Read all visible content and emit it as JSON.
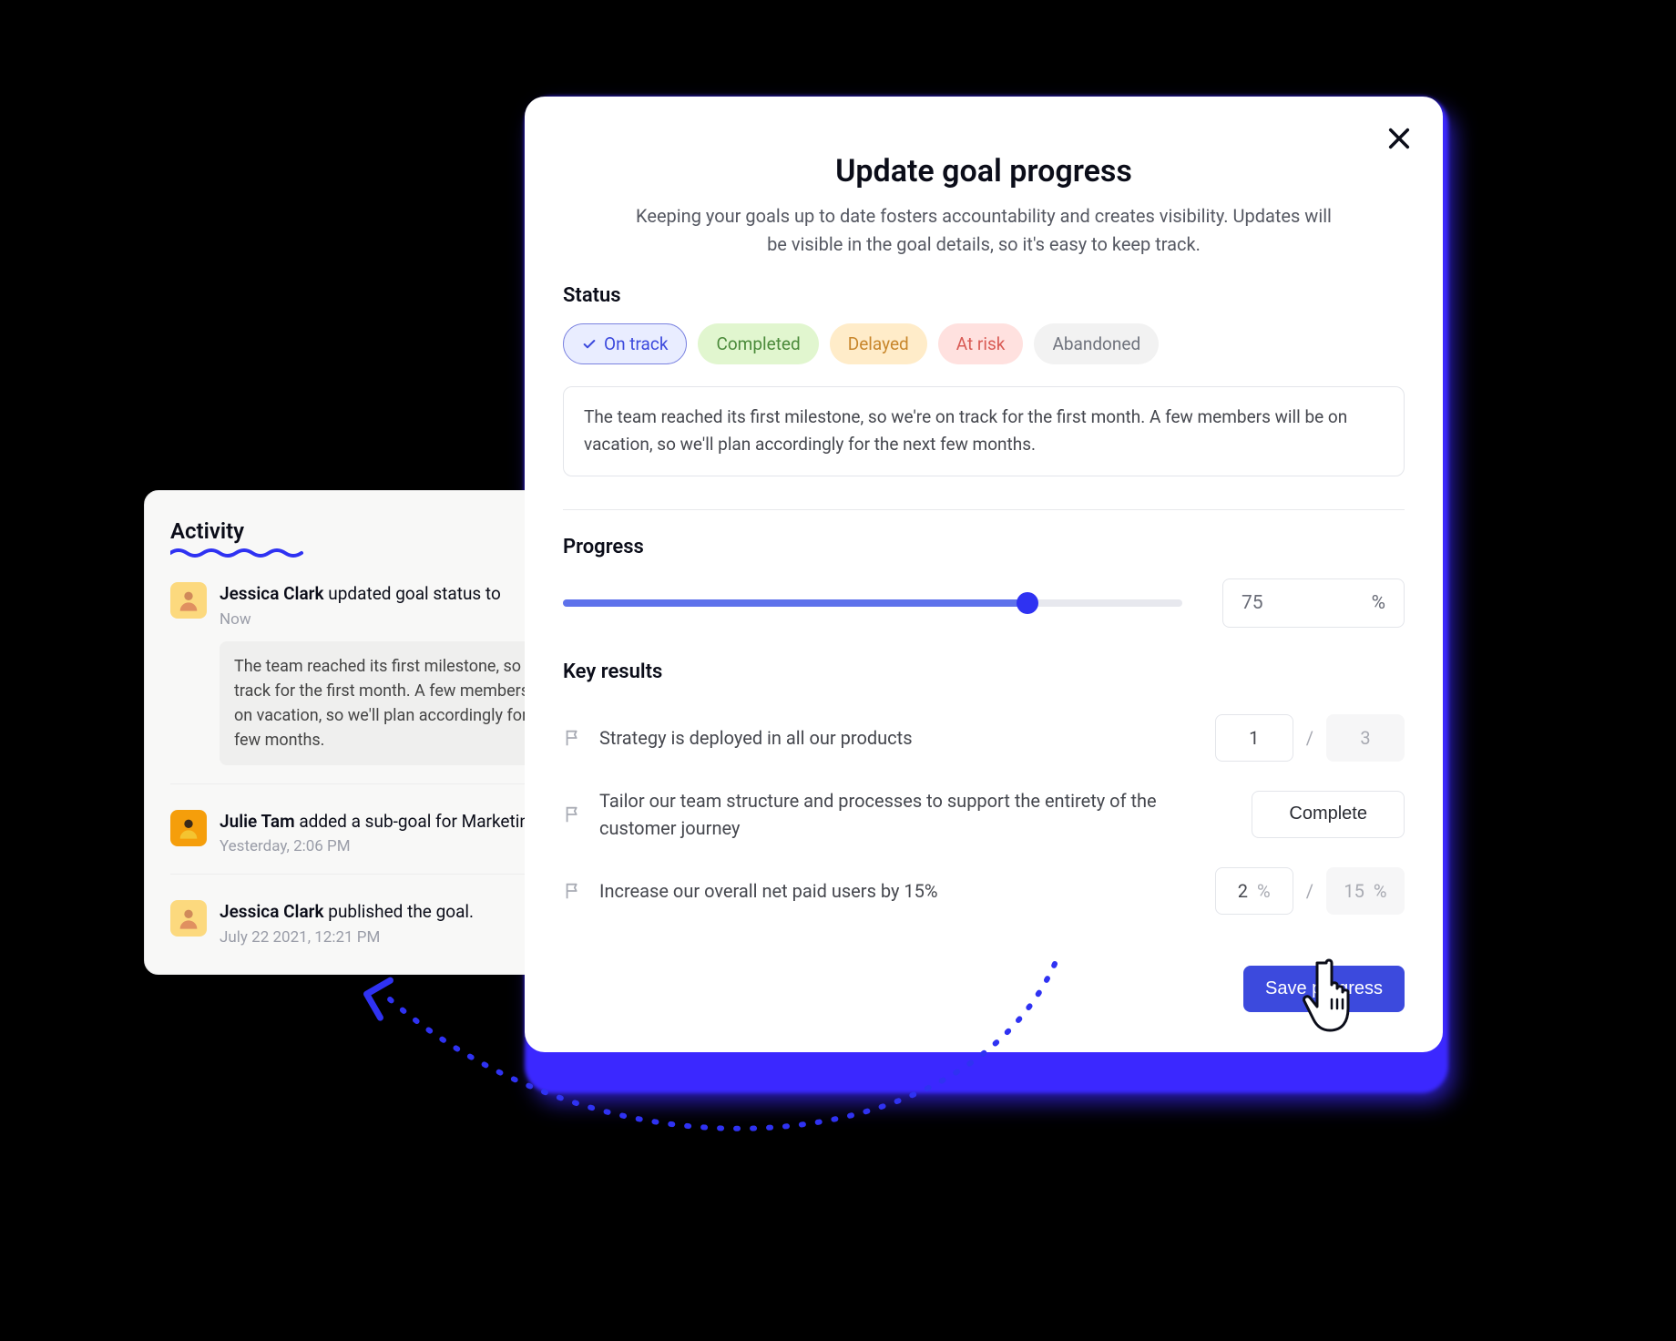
{
  "activity": {
    "title": "Activity",
    "items": [
      {
        "user": "Jessica Clark",
        "action": "updated goal status to",
        "time": "Now",
        "note": "The team reached its first milestone, so we're on track for the first month. A few members will be on vacation, so we'll plan accordingly for the next few months."
      },
      {
        "user": "Julie Tam",
        "action": "added a sub-goal for Marketing.",
        "time": "Yesterday, 2:06 PM"
      },
      {
        "user": "Jessica Clark",
        "action": "published the goal.",
        "time": "July 22 2021, 12:21 PM"
      }
    ]
  },
  "modal": {
    "title": "Update goal progress",
    "subtitle": "Keeping your goals up to date fosters accountability and creates visibility. Updates will be visible in the goal details, so it's easy to keep track.",
    "status_label": "Status",
    "statuses": {
      "on_track": "On track",
      "completed": "Completed",
      "delayed": "Delayed",
      "at_risk": "At risk",
      "abandoned": "Abandoned"
    },
    "note": "The team reached its first milestone, so we're on track for the first month. A few members will be on vacation, so we'll plan accordingly for the next few months.",
    "progress_label": "Progress",
    "progress_value": "75",
    "progress_unit": "%",
    "kr_label": "Key results",
    "krs": [
      {
        "text": "Strategy is deployed in all our products",
        "current": "1",
        "target": "3"
      },
      {
        "text": "Tailor our team structure and processes to support the entirety of the customer journey",
        "complete_label": "Complete"
      },
      {
        "text": "Increase our overall net paid users by 15%",
        "current": "2",
        "current_unit": "%",
        "target": "15",
        "target_unit": "%"
      }
    ],
    "save_label": "Save progress"
  },
  "colors": {
    "accent": "#3c4add"
  }
}
